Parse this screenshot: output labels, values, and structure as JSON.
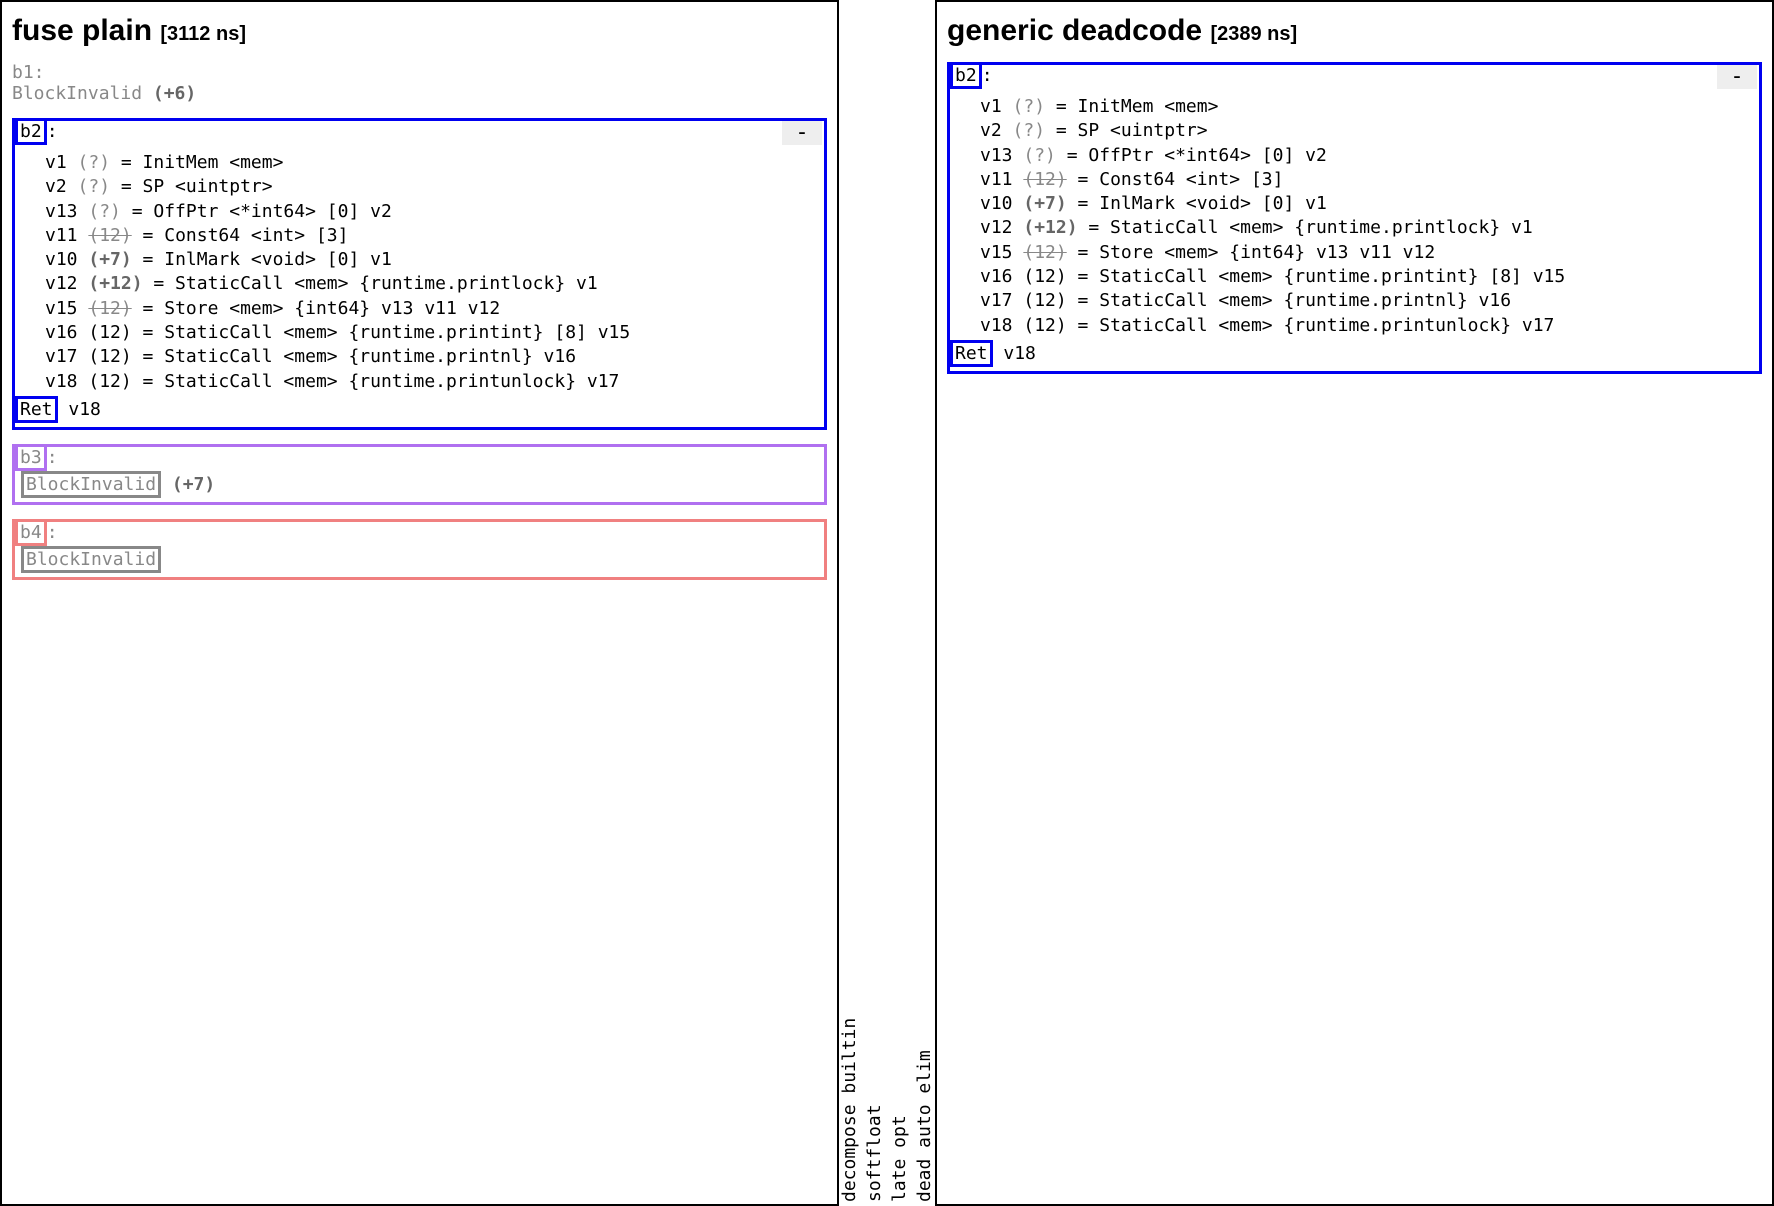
{
  "tabs": [
    "decompose builtin",
    "softfloat",
    "late opt",
    "dead auto elim"
  ],
  "left": {
    "title": "fuse plain",
    "timing": "[3112 ns]",
    "blocks": [
      {
        "id": "b1",
        "dead": true,
        "border": "none",
        "invalid": "BlockInvalid",
        "suffix": "(+6)"
      },
      {
        "id": "b2",
        "border": "blue",
        "collapse": "-",
        "ops": [
          {
            "v": "v1",
            "line": "(?)",
            "rest": " = InitMem <mem>",
            "lh": "gray"
          },
          {
            "v": "v2",
            "line": "(?)",
            "rest": " = SP <uintptr>",
            "lh": "gray"
          },
          {
            "v": "v13",
            "line": "(?)",
            "rest": " = OffPtr <*int64> [0] v2",
            "lh": "gray"
          },
          {
            "v": "v11",
            "line": "(12)",
            "rest": " = Const64 <int> [3]",
            "lh": "strike"
          },
          {
            "v": "v10",
            "line": "(+7)",
            "rest": " = InlMark <void> [0] v1",
            "lh": "bold"
          },
          {
            "v": "v12",
            "line": "(+12)",
            "rest": " = StaticCall <mem> {runtime.printlock} v1",
            "lh": "bold"
          },
          {
            "v": "v15",
            "line": "(12)",
            "rest": " = Store <mem> {int64} v13 v11 v12",
            "lh": "strike"
          },
          {
            "v": "v16",
            "line": "(12)",
            "rest": " = StaticCall <mem> {runtime.printint} [8] v15",
            "lh": "plain"
          },
          {
            "v": "v17",
            "line": "(12)",
            "rest": " = StaticCall <mem> {runtime.printnl} v16",
            "lh": "plain"
          },
          {
            "v": "v18",
            "line": "(12)",
            "rest": " = StaticCall <mem> {runtime.printunlock} v17",
            "lh": "plain"
          }
        ],
        "ret": "Ret",
        "ret_after": " v18"
      },
      {
        "id": "b3",
        "dead": true,
        "border": "purple",
        "invalid": "BlockInvalid",
        "invbox": "purple",
        "suffix": " (+7)"
      },
      {
        "id": "b4",
        "dead": true,
        "border": "red",
        "invalid": "BlockInvalid",
        "invbox": "red"
      }
    ]
  },
  "right": {
    "title": "generic deadcode",
    "timing": "[2389 ns]",
    "blocks": [
      {
        "id": "b2",
        "border": "blue",
        "collapse": "-",
        "ops": [
          {
            "v": "v1",
            "line": "(?)",
            "rest": " = InitMem <mem>",
            "lh": "gray"
          },
          {
            "v": "v2",
            "line": "(?)",
            "rest": " = SP <uintptr>",
            "lh": "gray"
          },
          {
            "v": "v13",
            "line": "(?)",
            "rest": " = OffPtr <*int64> [0] v2",
            "lh": "gray"
          },
          {
            "v": "v11",
            "line": "(12)",
            "rest": " = Const64 <int> [3]",
            "lh": "strike"
          },
          {
            "v": "v10",
            "line": "(+7)",
            "rest": " = InlMark <void> [0] v1",
            "lh": "bold"
          },
          {
            "v": "v12",
            "line": "(+12)",
            "rest": " = StaticCall <mem> {runtime.printlock} v1",
            "lh": "bold"
          },
          {
            "v": "v15",
            "line": "(12)",
            "rest": " = Store <mem> {int64} v13 v11 v12",
            "lh": "strike"
          },
          {
            "v": "v16",
            "line": "(12)",
            "rest": " = StaticCall <mem> {runtime.printint} [8] v15",
            "lh": "plain"
          },
          {
            "v": "v17",
            "line": "(12)",
            "rest": " = StaticCall <mem> {runtime.printnl} v16",
            "lh": "plain"
          },
          {
            "v": "v18",
            "line": "(12)",
            "rest": " = StaticCall <mem> {runtime.printunlock} v17",
            "lh": "plain"
          }
        ],
        "ret": "Ret",
        "ret_after": " v18"
      }
    ]
  }
}
